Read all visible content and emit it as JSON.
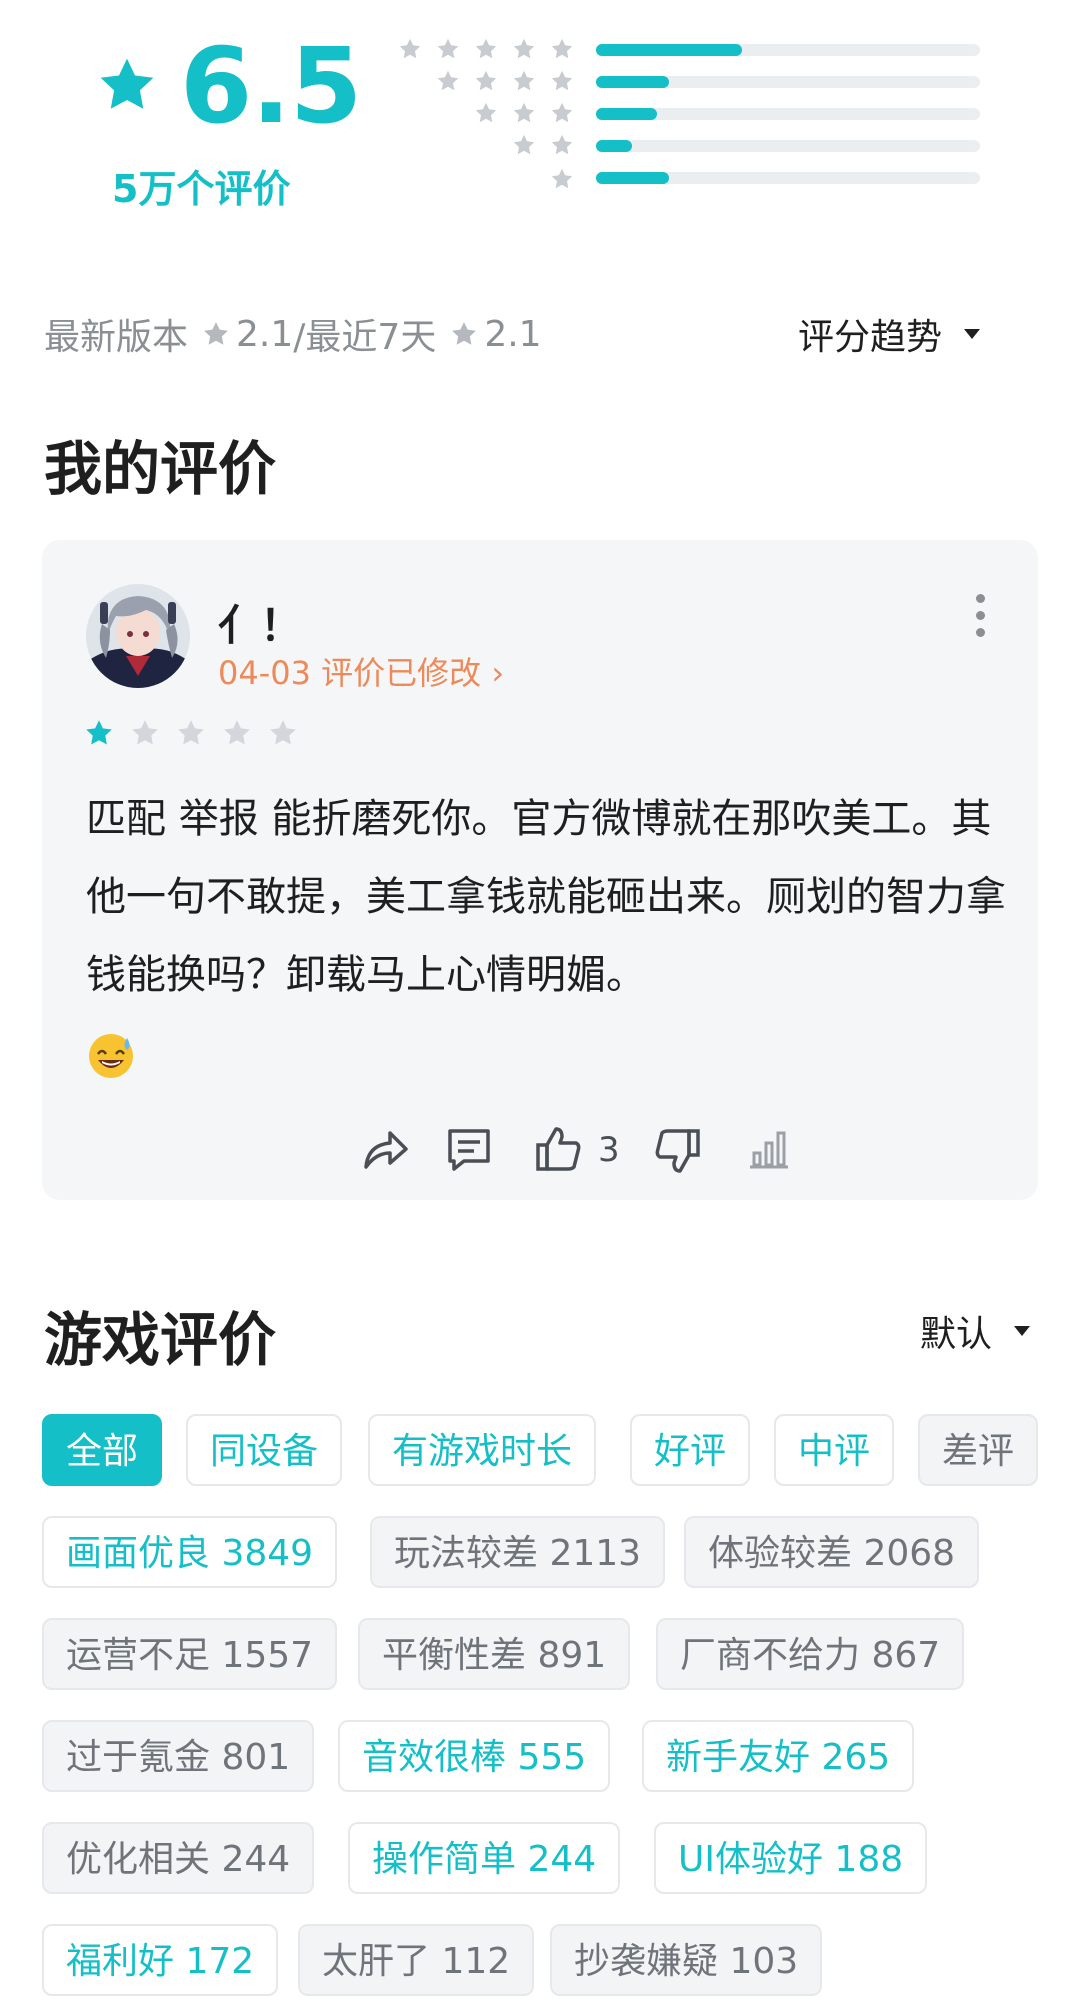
{
  "rating": {
    "score": "6.5",
    "count_label": "5万个评价",
    "distribution": [
      {
        "stars": 5,
        "fraction": 0.38
      },
      {
        "stars": 4,
        "fraction": 0.19
      },
      {
        "stars": 3,
        "fraction": 0.16
      },
      {
        "stars": 2,
        "fraction": 0.095
      },
      {
        "stars": 1,
        "fraction": 0.19
      }
    ]
  },
  "version_line": {
    "latest_label": "最新版本",
    "latest_score": "2.1",
    "separator": "/最近7天",
    "recent_score": "2.1",
    "trend_label": "评分趋势"
  },
  "my_review": {
    "section_title": "我的评价",
    "username": "亻！",
    "edited_label": "04-03 评价已修改 ›",
    "user_rating": 1,
    "text": "匹配 举报 能折磨死你。官方微博就在那吹美工。其他一句不敢提，美工拿钱就能砸出来。厕划的智力拿钱能换吗？卸载马上心情明媚。",
    "like_count": "3",
    "icons": [
      "share-icon",
      "comment-icon",
      "thumbs-up-icon",
      "thumbs-down-icon",
      "stats-icon"
    ]
  },
  "game_reviews": {
    "section_title": "游戏评价",
    "sort_label": "默认",
    "filters": [
      "全部",
      "同设备",
      "有游戏时长",
      "好评",
      "中评",
      "差评"
    ],
    "tags": [
      "画面优良 3849",
      "玩法较差 2113",
      "体验较差 2068",
      "运营不足 1557",
      "平衡性差 891",
      "厂商不给力 867",
      "过于氪金 801",
      "音效很棒 555",
      "新手友好 265",
      "优化相关 244",
      "操作简单 244",
      "UI体验好  188",
      "福利好 172",
      "太肝了 112",
      "抄袭嫌疑 103"
    ]
  },
  "colors": {
    "accent": "#15bfc8",
    "edited": "#ee8a5a",
    "muted": "#8a8f94"
  }
}
